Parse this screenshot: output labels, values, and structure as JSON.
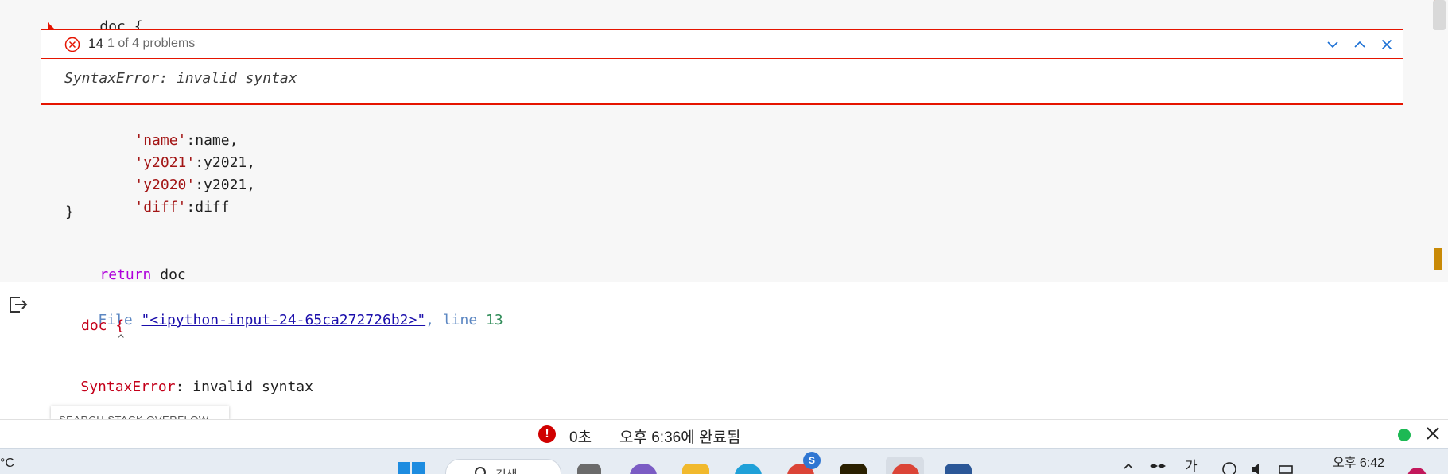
{
  "editor": {
    "line_doc_ident": "doc",
    "line_doc_brace": " {",
    "dict_lines": [
      {
        "key": "'name'",
        "rest": ":name,"
      },
      {
        "key": "'y2021'",
        "rest": ":y2021,"
      },
      {
        "key": "'y2020'",
        "rest": ":y2021,"
      },
      {
        "key": "'diff'",
        "rest": ":diff"
      }
    ],
    "close_brace": "}",
    "return_kw": "return",
    "return_ident": "doc"
  },
  "problem_peek": {
    "code": "14",
    "count": "1 of 4 problems",
    "message": "SyntaxError: invalid syntax",
    "colors": {
      "error": "#e51400"
    }
  },
  "output": {
    "file_label": "File ",
    "file_link": "\"<ipython-input-24-65ca272726b2>\"",
    "line_label": ", line ",
    "line_number": "13",
    "code_line": "doc {",
    "caret": "^",
    "error_type": "SyntaxError",
    "error_msg": ": invalid syntax",
    "search_button": "SEARCH STACK OVERFLOW"
  },
  "statusbar": {
    "elapsed": "0초",
    "completed": "오후 6:36에 완료됨",
    "colors": {
      "error": "#d00000",
      "ok": "#1db954"
    }
  },
  "taskbar": {
    "temperature": "°C",
    "search_label": "검색",
    "badge": "S",
    "ime": "가",
    "clock": "오후 6:42"
  }
}
